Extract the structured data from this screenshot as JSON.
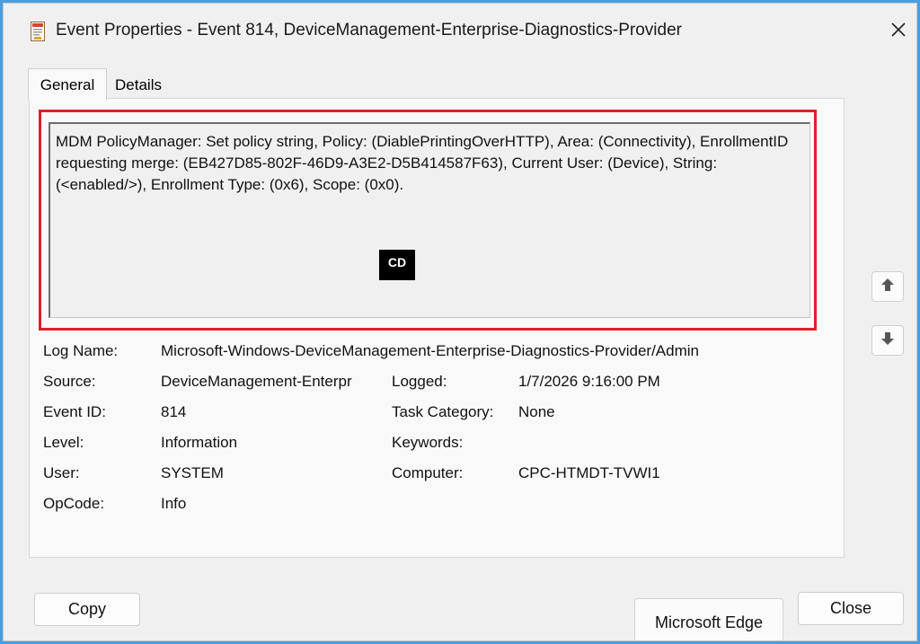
{
  "window": {
    "title": "Event Properties - Event 814, DeviceManagement-Enterprise-Diagnostics-Provider",
    "icon": "event-viewer-icon",
    "close_icon": "close-icon"
  },
  "tabs": [
    {
      "label": "General",
      "active": true
    },
    {
      "label": "Details",
      "active": false
    }
  ],
  "message": {
    "text": "MDM PolicyManager: Set policy string, Policy: (DiablePrintingOverHTTP), Area: (Connectivity), EnrollmentID requesting merge: (EB427D85-802F-46D9-A3E2-D5B414587F63), Current User: (Device), String: (<enabled/>), Enrollment Type: (0x6), Scope: (0x0).",
    "highlight_color": "#e0202a"
  },
  "logo": {
    "mark": "CD"
  },
  "fields": {
    "log_name": {
      "label": "Log Name:",
      "value": "Microsoft-Windows-DeviceManagement-Enterprise-Diagnostics-Provider/Admin"
    },
    "source": {
      "label": "Source:",
      "value": "DeviceManagement-Enterpr"
    },
    "logged": {
      "label": "Logged:",
      "value": "1/7/2026 9:16:00 PM"
    },
    "event_id": {
      "label": "Event ID:",
      "value": "814"
    },
    "task_category": {
      "label": "Task Category:",
      "value": "None"
    },
    "level": {
      "label": "Level:",
      "value": "Information"
    },
    "keywords": {
      "label": "Keywords:",
      "value": ""
    },
    "user": {
      "label": "User:",
      "value": "SYSTEM"
    },
    "computer": {
      "label": "Computer:",
      "value": "CPC-HTMDT-TVWI1"
    },
    "opcode": {
      "label": "OpCode:",
      "value": "Info"
    }
  },
  "buttons": {
    "copy": "Copy",
    "close": "Close",
    "edge_tab": "Microsoft Edge",
    "up_icon": "arrow-up-icon",
    "down_icon": "arrow-down-icon"
  }
}
